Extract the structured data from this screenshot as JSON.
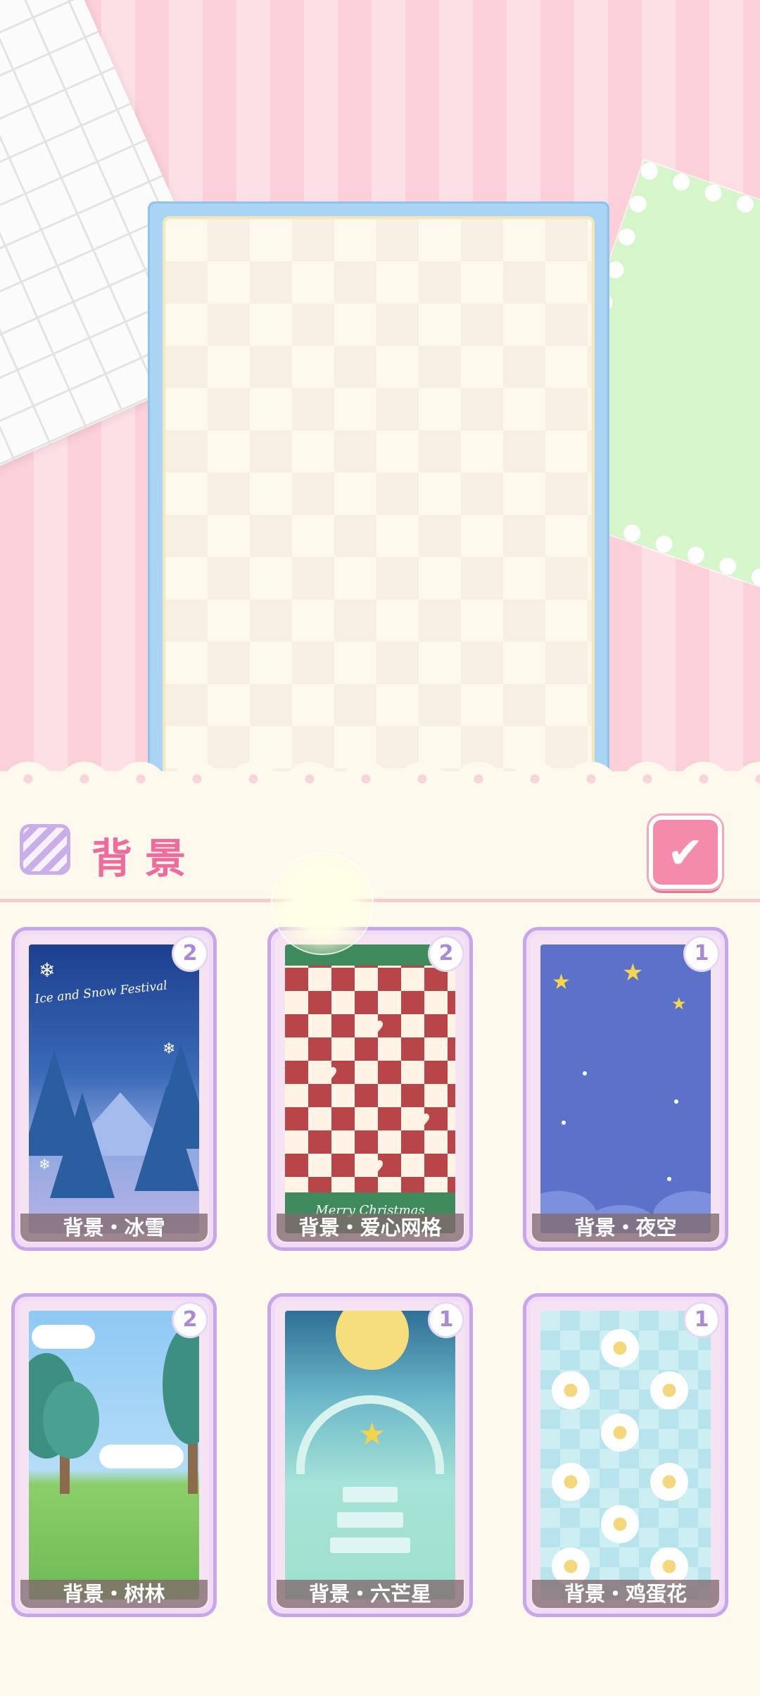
{
  "panel": {
    "title": "背景",
    "confirm_icon": "checkmark-icon",
    "category_icon": "striped-background-icon"
  },
  "colors": {
    "accent_pink": "#f06a9b",
    "card_border": "#c8a6ea",
    "frame_blue": "#a9d4f5"
  },
  "cards": [
    {
      "label": "背景・冰雪",
      "count": "2",
      "art_text": "Ice and Snow Festival"
    },
    {
      "label": "背景・爱心网格",
      "count": "2",
      "art_text": "Merry Christmas"
    },
    {
      "label": "背景・夜空",
      "count": "1"
    },
    {
      "label": "背景・树林",
      "count": "2"
    },
    {
      "label": "背景・六芒星",
      "count": "1"
    },
    {
      "label": "背景・鸡蛋花",
      "count": "1"
    }
  ]
}
